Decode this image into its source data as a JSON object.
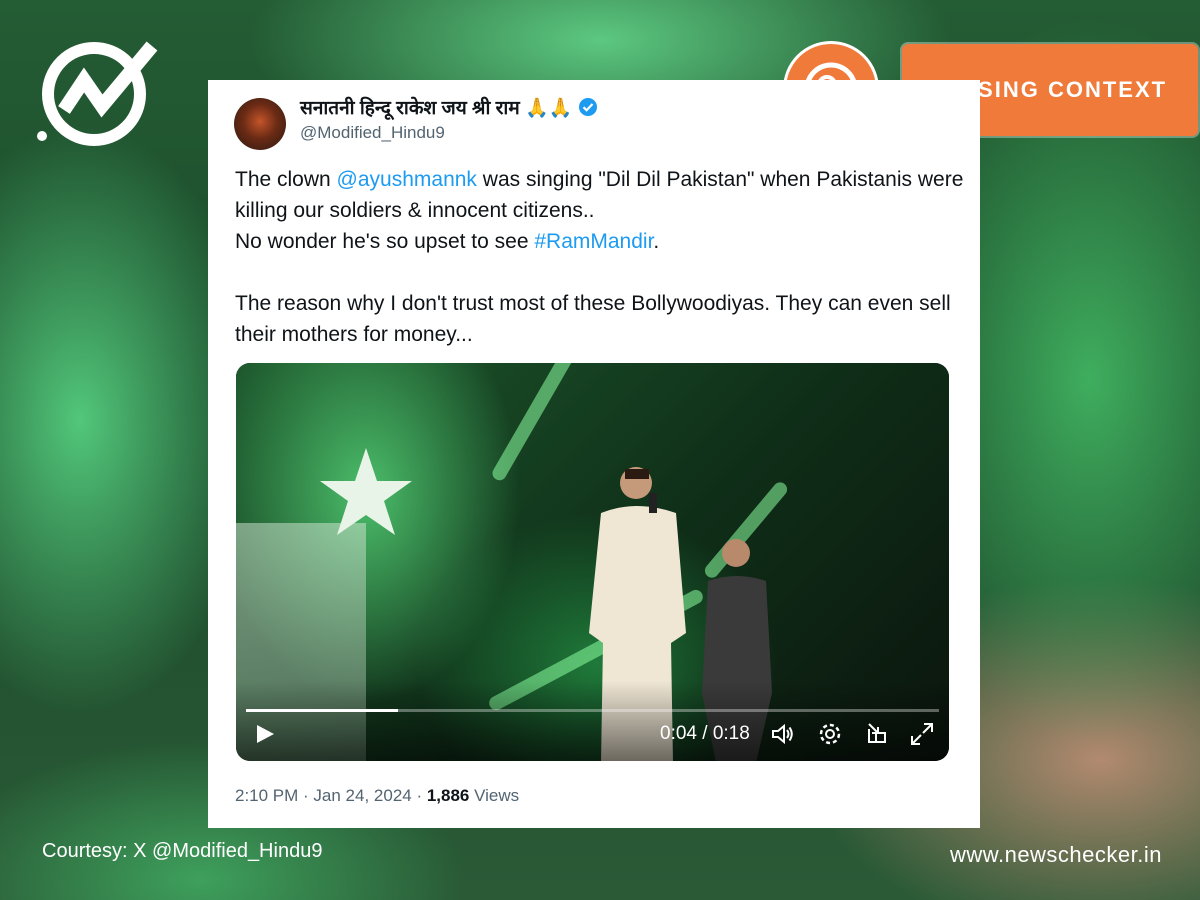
{
  "badge": {
    "label": "MISSING CONTEXT",
    "color": "#f07a3a"
  },
  "tweet": {
    "display_name": "सनातनी हिन्दू राकेश जय श्री राम 🙏🙏",
    "handle": "@Modified_Hindu9",
    "verified": true,
    "text_line1_pre": "The clown ",
    "text_mention": "@ayushmannk",
    "text_line1_post": " was singing \"Dil Dil Pakistan\" when Pakistanis were killing our soldiers & innocent citizens..",
    "text_line2_pre": "No wonder he's so upset to see ",
    "text_hashtag": "#RamMandir",
    "text_line2_post": ".",
    "text_para2": "The reason why I don't trust most of these Bollywoodiyas. They can even sell their mothers for money...",
    "link_color": "#1d9bf0",
    "video": {
      "current_time": "0:04",
      "duration": "0:18",
      "time_display": "0:04 / 0:18",
      "progress": 0.22
    },
    "timestamp": "2:10 PM · Jan 24, 2024 · ",
    "views_count": "1,886",
    "views_label": " Views"
  },
  "footer": {
    "courtesy": "Courtesy: X @Modified_Hindu9",
    "site": "www.newschecker.in"
  },
  "icons": [
    "newschecker-logo-icon",
    "magnifier-badge-icon",
    "verified-icon",
    "play-icon",
    "volume-icon",
    "settings-icon",
    "pip-icon",
    "fullscreen-icon"
  ]
}
